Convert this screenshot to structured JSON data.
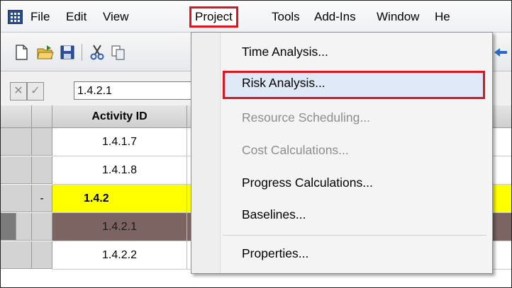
{
  "menubar": {
    "items": [
      "File",
      "Edit",
      "View",
      "Project",
      "Tools",
      "Add-Ins",
      "Window",
      "He"
    ],
    "active": "Project"
  },
  "toolbar": {
    "icons": [
      "new-icon",
      "open-icon",
      "save-icon",
      "cut-icon",
      "copy-icon"
    ]
  },
  "editbar": {
    "cancel_icon": "cancel-x-icon",
    "accept_icon": "accept-check-icon",
    "value": "1.4.2.1"
  },
  "grid": {
    "column_header": "Activity ID",
    "rows": [
      {
        "id": "1.4.1.7",
        "marker": "",
        "highlight": "none"
      },
      {
        "id": "1.4.1.8",
        "marker": "",
        "highlight": "none"
      },
      {
        "id": "1.4.2",
        "marker": "-",
        "highlight": "yellow"
      },
      {
        "id": "1.4.2.1",
        "marker": "",
        "highlight": "selected"
      },
      {
        "id": "1.4.2.2",
        "marker": "",
        "highlight": "none"
      }
    ]
  },
  "project_menu": {
    "items": [
      {
        "label": "Time Analysis...",
        "enabled": true
      },
      {
        "label": "Risk Analysis...",
        "enabled": true,
        "highlighted": true
      },
      {
        "label": "Resource Scheduling...",
        "enabled": false
      },
      {
        "label": "Cost Calculations...",
        "enabled": false
      },
      {
        "label": "Progress Calculations...",
        "enabled": true
      },
      {
        "label": "Baselines...",
        "enabled": true
      },
      {
        "label": "Properties...",
        "enabled": true
      }
    ]
  },
  "colors": {
    "callout_red": "#e0141e",
    "summary_yellow": "#ffff00",
    "selected_row": "#7b6461"
  }
}
